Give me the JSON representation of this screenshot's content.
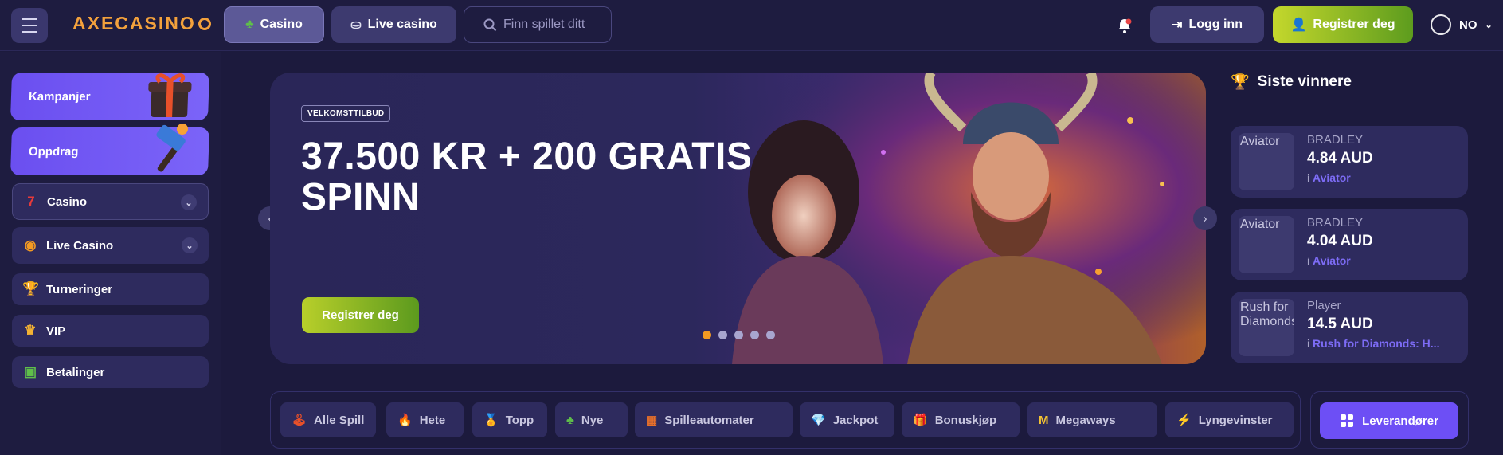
{
  "header": {
    "logo": "AXECASINO",
    "nav": {
      "casino": "Casino",
      "live_casino": "Live casino"
    },
    "search_placeholder": "Finn spillet ditt",
    "login": "Logg inn",
    "register": "Registrer deg",
    "language": "NO"
  },
  "sidebar": {
    "promos": [
      {
        "label": "Kampanjer"
      },
      {
        "label": "Oppdrag"
      }
    ],
    "items": [
      {
        "label": "Casino",
        "icon": "sevens-icon"
      },
      {
        "label": "Live Casino",
        "icon": "roulette-icon"
      },
      {
        "label": "Turneringer",
        "icon": "trophy-icon"
      },
      {
        "label": "VIP",
        "icon": "crown-icon"
      },
      {
        "label": "Betalinger",
        "icon": "wallet-icon"
      }
    ]
  },
  "banner": {
    "badge": "VELKOMSTTILBUD",
    "headline": "37.500 KR + 200 GRATIS SPINN",
    "cta": "Registrer deg",
    "slides": 5,
    "active_slide": 1
  },
  "winners": {
    "title": "Siste vinnere",
    "items": [
      {
        "name": "BRADLEY",
        "amount": "4.84 AUD",
        "prefix": "i",
        "game": "Aviator",
        "thumb_alt": "Aviator"
      },
      {
        "name": "BRADLEY",
        "amount": "4.04 AUD",
        "prefix": "i",
        "game": "Aviator",
        "thumb_alt": "Aviator"
      },
      {
        "name": "Player",
        "amount": "14.5 AUD",
        "prefix": "i",
        "game": "Rush for Diamonds: H...",
        "thumb_alt": "Rush for Diamonds"
      }
    ]
  },
  "categories": [
    {
      "label": "Alle Spill",
      "icon": "joystick-icon"
    },
    {
      "label": "Hete",
      "icon": "fire-icon"
    },
    {
      "label": "Topp",
      "icon": "medal-icon"
    },
    {
      "label": "Nye",
      "icon": "clover-icon"
    },
    {
      "label": "Spilleautomater",
      "icon": "slot-icon"
    },
    {
      "label": "Jackpot",
      "icon": "diamond-icon"
    },
    {
      "label": "Bonuskjøp",
      "icon": "gift-icon"
    },
    {
      "label": "Megaways",
      "icon": "megaways-icon"
    },
    {
      "label": "Lyngevinster",
      "icon": "lightning-icon"
    },
    {
      "label": "",
      "icon": "gem-icon"
    }
  ],
  "providers_button": "Leverandører",
  "colors": {
    "accent": "#6d4ff5",
    "cta": "#b8cf2a",
    "bg": "#1c1a3d"
  }
}
